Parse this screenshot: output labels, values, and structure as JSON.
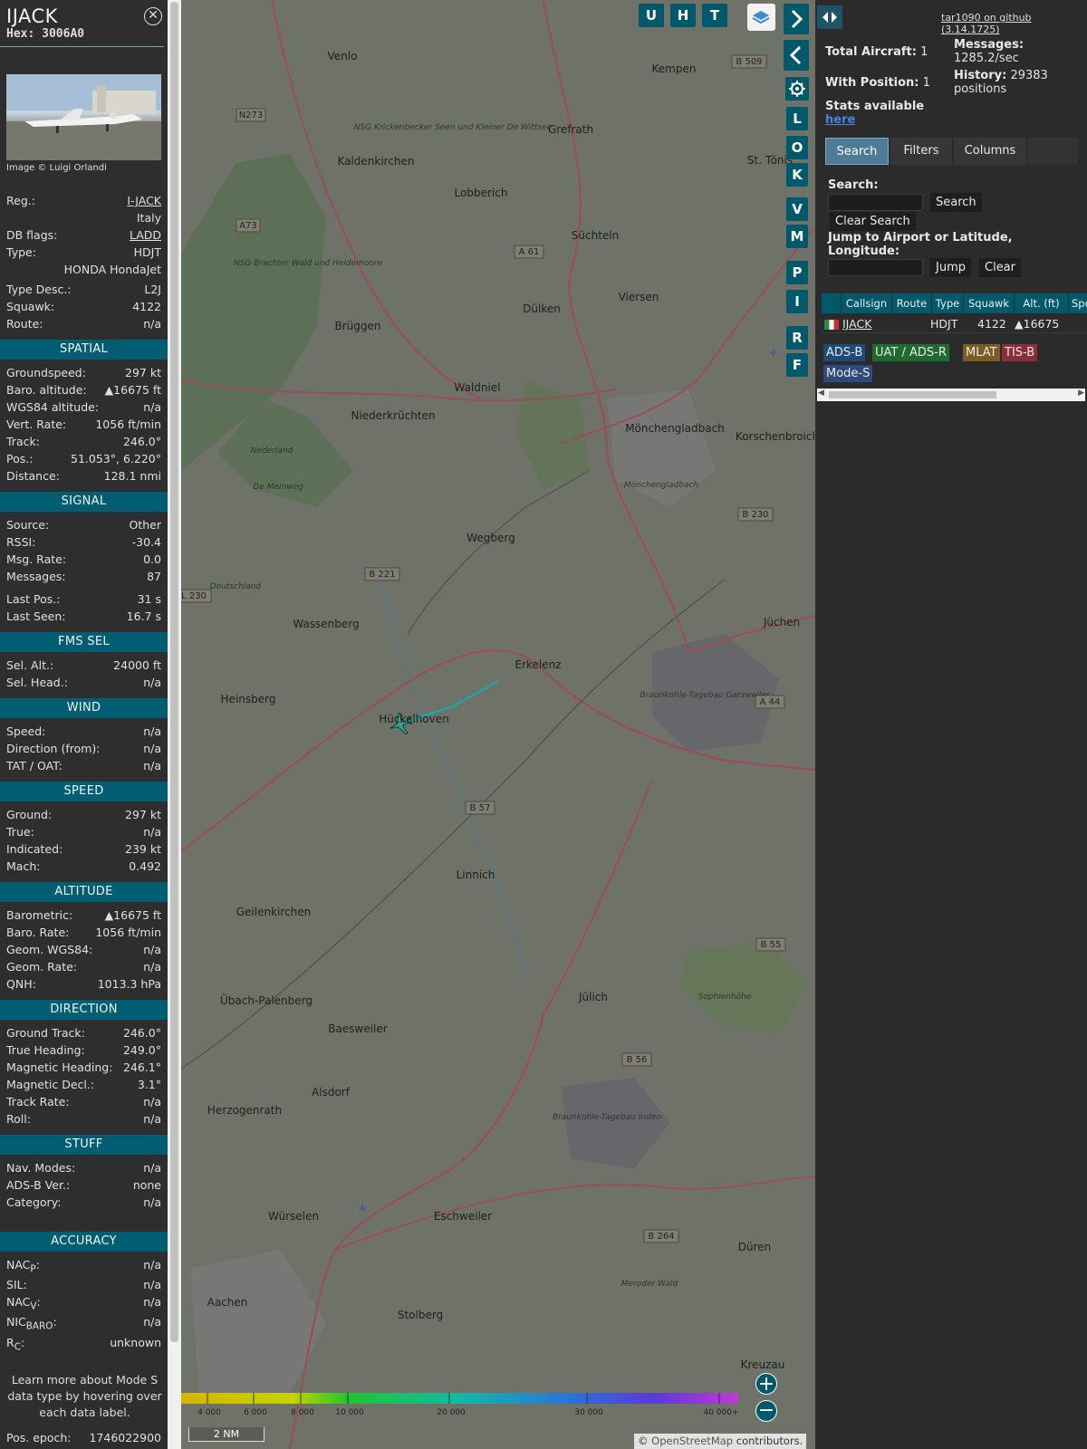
{
  "sidebar": {
    "callsign": "IJACK",
    "hex": "Hex: 3006A0",
    "close": "⊗",
    "credit": "Image © Luigi Orlandi",
    "reg_label": "Reg.:",
    "reg": "I-JACK",
    "country": "Italy",
    "dbflags_label": "DB flags:",
    "dbflags": "LADD",
    "type_label": "Type:",
    "type": "HDJT",
    "model": "HONDA HondaJet",
    "typedesc_label": "Type Desc.:",
    "typedesc": "L2J",
    "squawk_label": "Squawk:",
    "squawk": "4122",
    "route_label": "Route:",
    "route": "n/a",
    "spatial": "SPATIAL",
    "gs_label": "Groundspeed:",
    "gs": "297 kt",
    "baro_label": "Baro. altitude:",
    "baro": "▲16675 ft",
    "wgs_label": "WGS84 altitude:",
    "wgs": "n/a",
    "vr_label": "Vert. Rate:",
    "vr": "1056 ft/min",
    "track_label": "Track:",
    "track": "246.0°",
    "pos_label": "Pos.:",
    "pos": "51.053°, 6.220°",
    "dist_label": "Distance:",
    "dist": "128.1 nmi",
    "signal": "SIGNAL",
    "src_label": "Source:",
    "src": "Other",
    "rssi_label": "RSSI:",
    "rssi": "-30.4",
    "msgrate_label": "Msg. Rate:",
    "msgrate": "0.0",
    "msgs_label": "Messages:",
    "msgs": "87",
    "lastpos_label": "Last Pos.:",
    "lastpos": "31 s",
    "lastseen_label": "Last Seen:",
    "lastseen": "16.7 s",
    "fms": "FMS SEL",
    "selalt_label": "Sel. Alt.:",
    "selalt": "24000 ft",
    "selhead_label": "Sel. Head.:",
    "selhead": "n/a",
    "wind": "WIND",
    "wspeed_label": "Speed:",
    "wspeed": "n/a",
    "wdir_label": "Direction (from):",
    "wdir": "n/a",
    "tat_label": "TAT / OAT:",
    "tat": "n/a",
    "speed": "SPEED",
    "sground_label": "Ground:",
    "sground": "297 kt",
    "strue_label": "True:",
    "strue": "n/a",
    "sind_label": "Indicated:",
    "sind": "239 kt",
    "mach_label": "Mach:",
    "mach": "0.492",
    "altitude": "ALTITUDE",
    "abaro_label": "Barometric:",
    "abaro": "▲16675 ft",
    "arate_label": "Baro. Rate:",
    "arate": "1056 ft/min",
    "geom_label": "Geom. WGS84:",
    "geom": "n/a",
    "georate_label": "Geom. Rate:",
    "georate": "n/a",
    "qnh_label": "QNH:",
    "qnh": "1013.3 hPa",
    "direction": "DIRECTION",
    "gt_label": "Ground Track:",
    "gt": "246.0°",
    "th_label": "True Heading:",
    "th": "249.0°",
    "mh_label": "Magnetic Heading:",
    "mh": "246.1°",
    "md_label": "Magnetic Decl.:",
    "md": "3.1°",
    "tr_label": "Track Rate:",
    "tr": "n/a",
    "roll_label": "Roll:",
    "roll": "n/a",
    "stuff": "STUFF",
    "nav_label": "Nav. Modes:",
    "nav": "n/a",
    "adsb_label": "ADS-B Ver.:",
    "adsb": "none",
    "cat_label": "Category:",
    "cat": "n/a",
    "accuracy": "ACCURACY",
    "nacp": "NAC",
    "nacp_sub": "P",
    "nacp_v": "n/a",
    "sil_label": "SIL:",
    "sil": "n/a",
    "nacv": "NAC",
    "nacv_sub": "V",
    "nacv_v": "n/a",
    "nic": "NIC",
    "nic_sub": "BARO",
    "nic_v": "n/a",
    "rc": "R",
    "rc_sub": "C",
    "rc_v": "unknown",
    "learn": "Learn more about Mode S data type by hovering over each data label.",
    "epoch_label": "Pos. epoch:",
    "epoch": "1746022900"
  },
  "map": {
    "buttons": [
      "U",
      "H",
      "T"
    ],
    "side_buttons": [
      "L",
      "O",
      "K",
      "V",
      "M",
      "P",
      "I",
      "R",
      "F"
    ],
    "legend_ticks": [
      "4 000",
      "6 000",
      "8 000",
      "10 000",
      "20 000",
      "30 000",
      "40 000+"
    ],
    "scale": "2 NM",
    "attribution_pre": "© ",
    "attribution_link": "OpenStreetMap",
    "attribution_post": " contributors.",
    "towns": [
      "Venlo",
      "Kempen",
      "Grefrath",
      "Kaldenkirchen",
      "Lobberich",
      "Süchteln",
      "Dülken",
      "Viersen",
      "Brüggen",
      "Waldniel",
      "Niederkrüchten",
      "Mönchengladbach",
      "Korschenbroich",
      "St. Tönis",
      "Wegberg",
      "Wassenberg",
      "Erkelenz",
      "Jüchen",
      "Heinsberg",
      "Hückelhoven",
      "Linnich",
      "Geilenkirchen",
      "Übach-Palenberg",
      "Baesweiler",
      "Jülich",
      "Alsdorf",
      "Herzogenrath",
      "Würselen",
      "Eschweiler",
      "Düren",
      "Aachen",
      "Stolberg",
      "Kreuzau"
    ],
    "nature": [
      "NSG Krickenbecker Seen und Kleiner De Wittsee",
      "NSG Brachter Wald und Heidemoore",
      "De Meinweg",
      "Braunkohle-Tagebau Garzweiler",
      "Braunkohle-Tagebau Inden",
      "Sophienhöhe",
      "Meroder Wald",
      "Mönchengladbach",
      "Deutschland",
      "Nederland"
    ],
    "roads": [
      "B 509",
      "N273",
      "A73",
      "A 61",
      "B 230",
      "B 221",
      "L 230",
      "A 44",
      "B 57",
      "B 55",
      "B 56",
      "B 264"
    ]
  },
  "panel": {
    "github": "tar1090 on github (3.14.1725)",
    "total_label": "Total Aircraft:",
    "total": "1",
    "withpos_label": "With Position:",
    "withpos": "1",
    "msgs_label": "Messages:",
    "msgs": "1285.2/sec",
    "history_label": "History:",
    "history": "29383 positions",
    "stats_label": "Stats available",
    "stats_link": "here",
    "tabs": [
      "Search",
      "Filters",
      "Columns"
    ],
    "search_label": "Search:",
    "search_btn": "Search",
    "clear_search": "Clear Search",
    "jump_label": "Jump to Airport or Latitude, Longitude:",
    "jump_btn": "Jump",
    "clear_btn": "Clear",
    "columns": [
      "Callsign",
      "Route",
      "Type",
      "Squawk",
      "Alt. (ft)",
      "Spd"
    ],
    "row": {
      "callsign": "IJACK",
      "route": "",
      "type": "HDJT",
      "squawk": "4122",
      "alt": "▲16675"
    },
    "badges": [
      "ADS-B",
      "UAT / ADS-R",
      "MLAT",
      "TIS-B",
      "Mode-S"
    ],
    "badge_colors": [
      "#1e4a7a",
      "#1f6b2f",
      "#7a5c24",
      "#8a2e37",
      "#2f4a7a"
    ]
  }
}
